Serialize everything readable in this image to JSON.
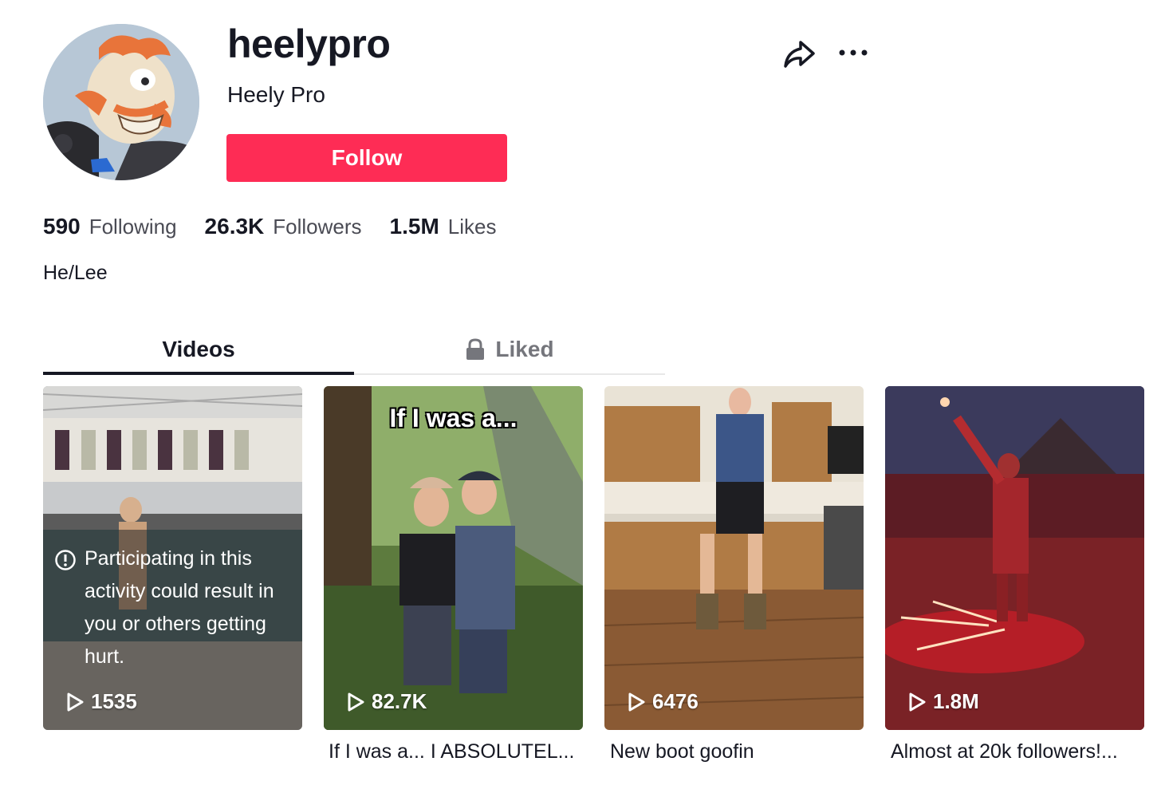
{
  "profile": {
    "username": "heelypro",
    "nickname": "Heely Pro",
    "follow_label": "Follow",
    "bio": "He/Lee"
  },
  "stats": {
    "following_count": "590",
    "following_label": "Following",
    "followers_count": "26.3K",
    "followers_label": "Followers",
    "likes_count": "1.5M",
    "likes_label": "Likes"
  },
  "tabs": {
    "videos_label": "Videos",
    "liked_label": "Liked",
    "active": "Videos"
  },
  "videos": [
    {
      "views": "1535",
      "warning": "Participating in this activity could result in you or others getting hurt.",
      "caption": ""
    },
    {
      "views": "82.7K",
      "overlay": "If I was a...",
      "caption": "If I was a... I ABSOLUTEL..."
    },
    {
      "views": "6476",
      "caption": "New boot goofin"
    },
    {
      "views": "1.8M",
      "caption": "Almost at 20k followers!..."
    }
  ],
  "icons": {
    "share": "share-icon",
    "more": "more-icon",
    "lock": "lock-icon",
    "play": "play-icon",
    "warning": "warning-icon"
  },
  "colors": {
    "follow_button": "#fe2c55",
    "text_primary": "#161823",
    "text_secondary": "#4a4b54",
    "tab_inactive": "#75767c"
  }
}
